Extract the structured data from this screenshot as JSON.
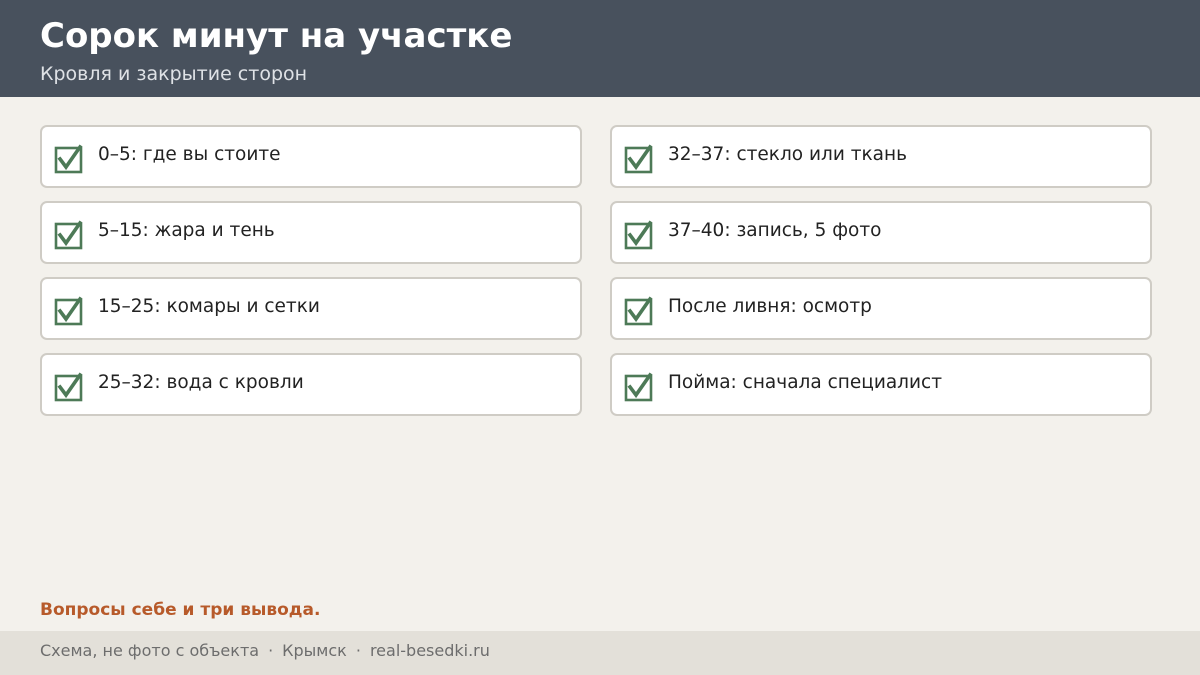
{
  "header": {
    "title": "Сорок минут на участке",
    "subtitle": "Кровля и закрытие сторон"
  },
  "checklist": {
    "left": [
      {
        "label": "0–5: где вы стоите",
        "checked": true
      },
      {
        "label": "5–15: жара и тень",
        "checked": true
      },
      {
        "label": "15–25: комары и сетки",
        "checked": true
      },
      {
        "label": "25–32: вода с кровли",
        "checked": true
      }
    ],
    "right": [
      {
        "label": "32–37: стекло или ткань",
        "checked": true
      },
      {
        "label": "37–40: запись, 5 фото",
        "checked": true
      },
      {
        "label": "После ливня: осмотр",
        "checked": true
      },
      {
        "label": "Пойма: сначала специалист",
        "checked": true
      }
    ]
  },
  "note": "Вопросы себе и три вывода.",
  "footer": {
    "items": [
      "Схема, не фото с объекта",
      "Крымск",
      "real-besedki.ru"
    ],
    "separator": "·"
  },
  "icons": {
    "checkbox": "checked-checkbox-icon"
  },
  "colors": {
    "header_bg": "#48515d",
    "background": "#f3f1ec",
    "check_green": "#4d7a57",
    "accent_orange": "#b75a2a",
    "footer_bg": "#e3e0d9"
  }
}
